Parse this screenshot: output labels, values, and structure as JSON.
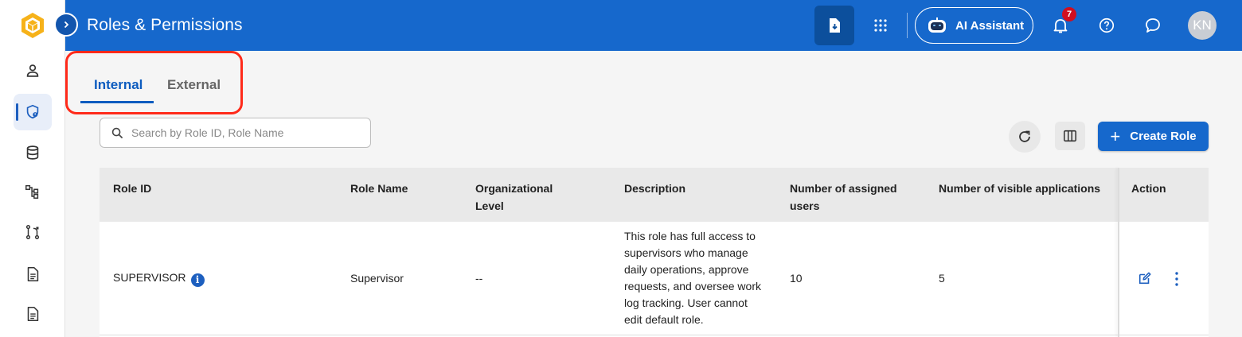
{
  "header": {
    "title": "Roles & Permissions",
    "ai_assistant_label": "AI Assistant",
    "notification_count": "7",
    "avatar_initials": "KN"
  },
  "sidebar": {
    "items": [
      {
        "icon": "user-icon"
      },
      {
        "icon": "shield-user-icon",
        "active": true
      },
      {
        "icon": "database-icon"
      },
      {
        "icon": "hierarchy-icon"
      },
      {
        "icon": "git-compare-icon"
      },
      {
        "icon": "document-icon"
      },
      {
        "icon": "document-icon"
      }
    ]
  },
  "tabs": [
    {
      "label": "Internal",
      "active": true
    },
    {
      "label": "External",
      "active": false
    }
  ],
  "search": {
    "placeholder": "Search by Role ID, Role Name",
    "value": ""
  },
  "toolbar": {
    "create_label": "Create Role"
  },
  "table": {
    "columns": [
      "Role ID",
      "Role Name",
      "Organizational Level",
      "Description",
      "Number of assigned users",
      "Number of visible applications",
      "Action"
    ],
    "rows": [
      {
        "role_id": "SUPERVISOR",
        "role_name": "Supervisor",
        "org_level": "--",
        "description": "This role has full access to supervisors who manage daily operations, approve requests, and oversee work log tracking. User cannot edit default role.",
        "assigned_users": "10",
        "visible_apps": "5"
      }
    ]
  },
  "colors": {
    "brand": "#1668cc",
    "accent": "#0d5cbf",
    "highlight": "#ff2a1a",
    "badge": "#d10f1f"
  }
}
